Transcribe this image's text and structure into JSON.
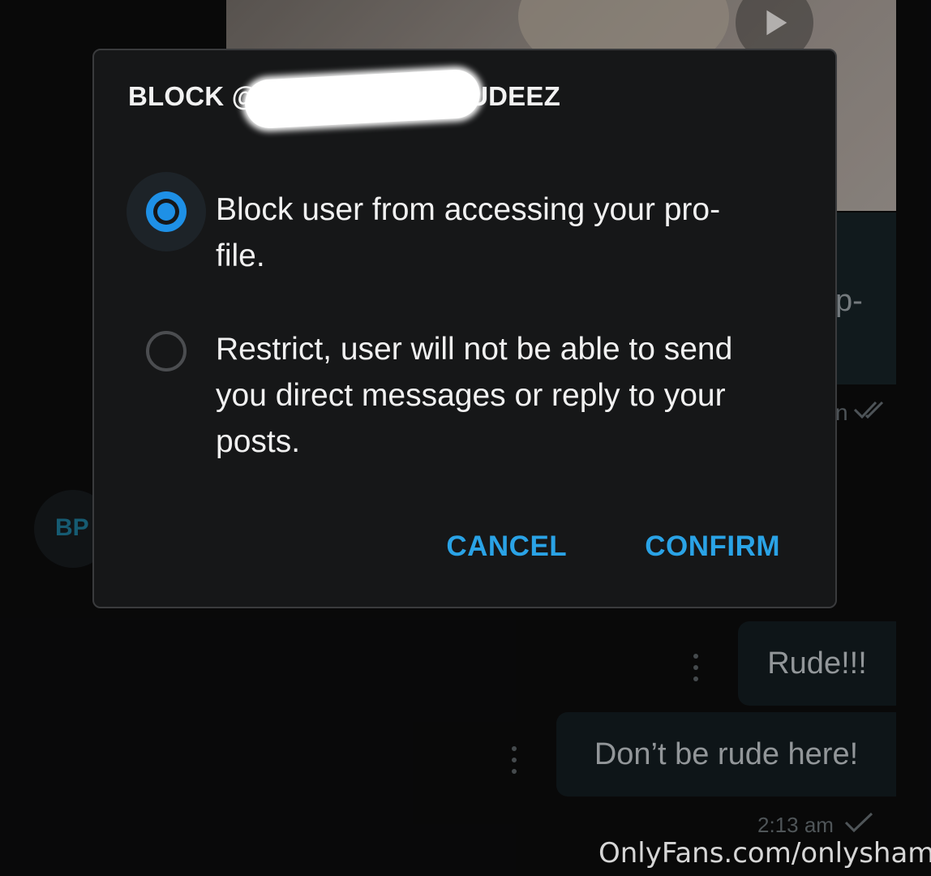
{
  "dialog": {
    "title": "BLOCK @U",
    "title_tail": "UDEEZ",
    "options": [
      {
        "label": "Block user from accessing your pro-\nfile.",
        "selected": true
      },
      {
        "label": "Restrict, user will not be able to send\nyou direct messages or reply to your\nposts.",
        "selected": false
      }
    ],
    "cancel_label": "CANCEL",
    "confirm_label": "CONFIRM"
  },
  "background_chat": {
    "partial_bubble_text": "p-",
    "partial_meta_text": "n",
    "avatar_initials": "BP",
    "messages": [
      {
        "text": "Rude!!!"
      },
      {
        "text": "Don’t be rude here!"
      }
    ],
    "timestamp": "2:13 am"
  },
  "watermark": "OnlyFans.com/onlyshams",
  "colors": {
    "accent": "#2aa3e6",
    "radio_selected": "#1e90e6",
    "dialog_bg": "#161718",
    "page_bg": "#0b0b0c"
  },
  "icons": {
    "play": "play-icon",
    "read_receipt": "double-check-icon",
    "sent": "check-icon",
    "more": "kebab-menu-icon"
  }
}
